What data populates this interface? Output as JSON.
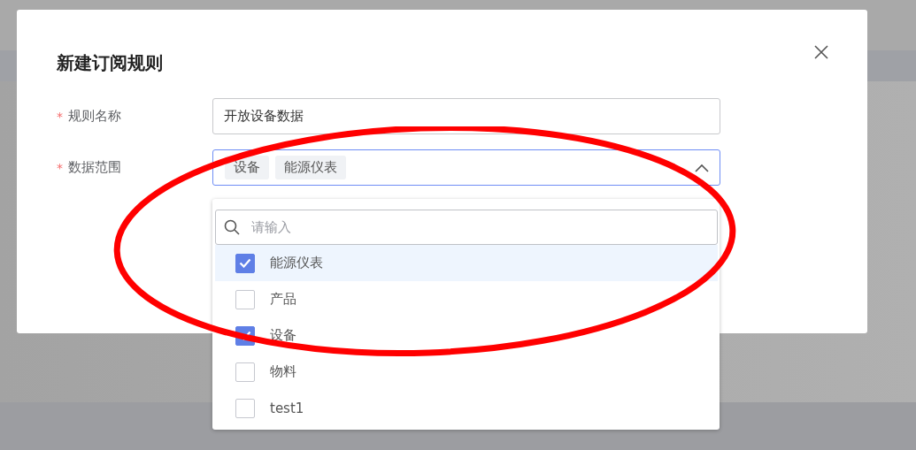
{
  "dialog": {
    "title": "新建订阅规则",
    "fields": [
      {
        "kind": "text",
        "required_mark": "*",
        "label": "规则名称",
        "value": "开放设备数据"
      },
      {
        "kind": "multiselect",
        "required_mark": "*",
        "label": "数据范围",
        "expanded": true,
        "tags": [
          "设备",
          "能源仪表"
        ]
      }
    ]
  },
  "dropdown": {
    "search": {
      "placeholder": "请输入"
    },
    "options": [
      {
        "label": "能源仪表",
        "checked": true,
        "highlighted": true
      },
      {
        "label": "产品",
        "checked": false,
        "highlighted": false
      },
      {
        "label": "设备",
        "checked": true,
        "highlighted": false
      },
      {
        "label": "物料",
        "checked": false,
        "highlighted": false
      },
      {
        "label": "test1",
        "checked": false,
        "highlighted": false
      }
    ]
  },
  "annotation": {
    "kind": "ellipse"
  }
}
